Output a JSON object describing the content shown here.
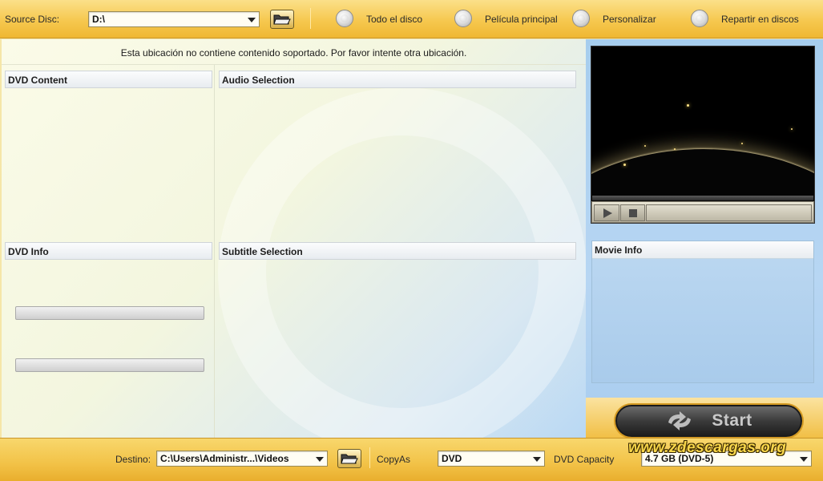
{
  "toolbar": {
    "source_label": "Source Disc:",
    "source_value": "D:\\",
    "modes": [
      "Todo el disco",
      "Película principal",
      "Personalizar",
      "Repartir en discos"
    ]
  },
  "main": {
    "message": "Esta ubicación no contiene contenido soportado. Por favor intente otra ubicación.",
    "panels": {
      "dvd_content": "DVD Content",
      "audio_selection": "Audio Selection",
      "dvd_info": "DVD Info",
      "subtitle_selection": "Subtitle Selection",
      "movie_info": "Movie Info"
    }
  },
  "start": {
    "label": "Start"
  },
  "bottom": {
    "dest_label": "Destino:",
    "dest_value": "C:\\Users\\Administr...\\Videos",
    "copyas_label": "CopyAs",
    "copyas_value": "DVD",
    "capacity_label": "DVD Capacity",
    "capacity_value": "4.7 GB (DVD-5)"
  },
  "watermark": "www.zdescargas.org",
  "colors": {
    "toolbar": "#f6c84f",
    "content": "#f3f6df",
    "right_panel": "#b7d6f3",
    "start_button": "#3b3b3b"
  }
}
